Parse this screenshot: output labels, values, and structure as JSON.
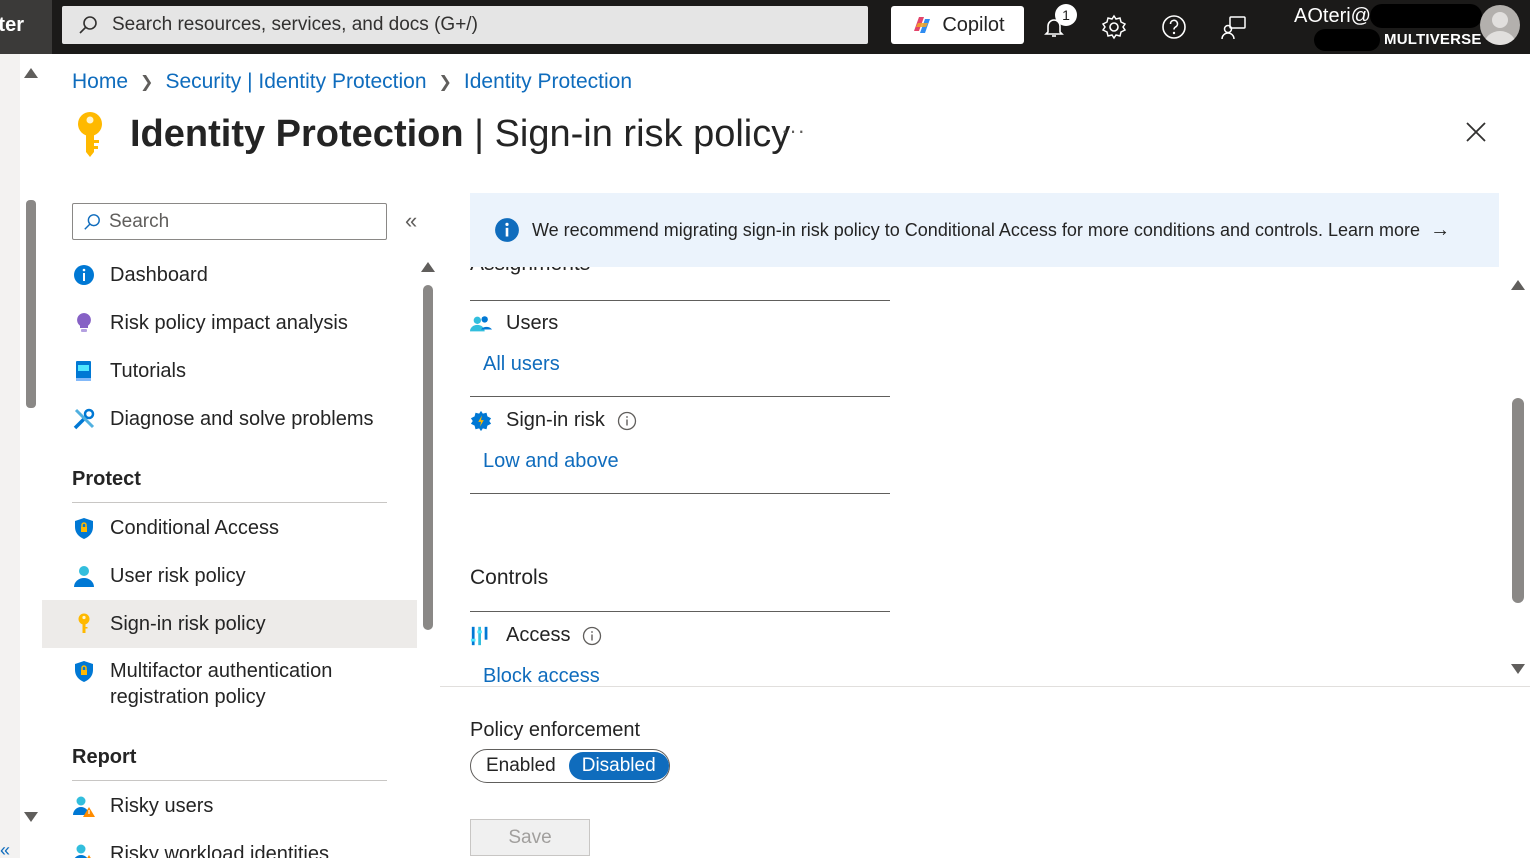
{
  "topbar": {
    "brand_fragment": "ter",
    "search_placeholder": "Search resources, services, and docs (G+/)",
    "copilot_label": "Copilot",
    "notification_count": "1",
    "user_name": "AOteri@",
    "user_org": "MULTIVERSE",
    "icons": [
      "search-icon",
      "copilot-icon",
      "bell-icon",
      "gear-icon",
      "help-icon",
      "feedback-icon",
      "avatar"
    ]
  },
  "breadcrumb": [
    "Home",
    "Security | Identity Protection",
    "Identity Protection"
  ],
  "title": {
    "service": "Identity Protection",
    "separator": " | ",
    "page": "Sign-in risk policy",
    "more": "···"
  },
  "nav": {
    "search_placeholder": "Search",
    "collapse_glyph": "«",
    "items": [
      {
        "label": "Dashboard",
        "icon": "info-icon"
      },
      {
        "label": "Risk policy impact analysis",
        "icon": "bulb-icon"
      },
      {
        "label": "Tutorials",
        "icon": "book-icon"
      },
      {
        "label": "Diagnose and solve problems",
        "icon": "wrench-icon"
      }
    ],
    "protect_heading": "Protect",
    "protect_items": [
      {
        "label": "Conditional Access",
        "icon": "shield-icon"
      },
      {
        "label": "User risk policy",
        "icon": "user-icon"
      },
      {
        "label": "Sign-in risk policy",
        "icon": "key-icon",
        "selected": true
      },
      {
        "label": "Multifactor authentication registration policy",
        "icon": "shield-lock-icon"
      }
    ],
    "report_heading": "Report",
    "report_items": [
      {
        "label": "Risky users",
        "icon": "risky-users-icon"
      },
      {
        "label": "Risky workload identities",
        "icon": "risky-workload-icon"
      }
    ]
  },
  "banner": {
    "text": "We recommend migrating sign-in risk policy to Conditional Access for more conditions and controls. Learn more",
    "arrow": "→"
  },
  "assignments": {
    "heading": "Assignments",
    "users_label": "Users",
    "users_value": "All users",
    "signin_risk_label": "Sign-in risk",
    "signin_risk_value": "Low and above"
  },
  "controls": {
    "heading": "Controls",
    "access_label": "Access",
    "access_value": "Block access"
  },
  "enforcement": {
    "label": "Policy enforcement",
    "options": [
      "Enabled",
      "Disabled"
    ],
    "selected": "Disabled"
  },
  "save_label": "Save",
  "colors": {
    "accent": "#0f6cbd",
    "topbar": "#1b1a19",
    "banner": "#ebf3fc",
    "selected_nav": "#edebe9"
  }
}
